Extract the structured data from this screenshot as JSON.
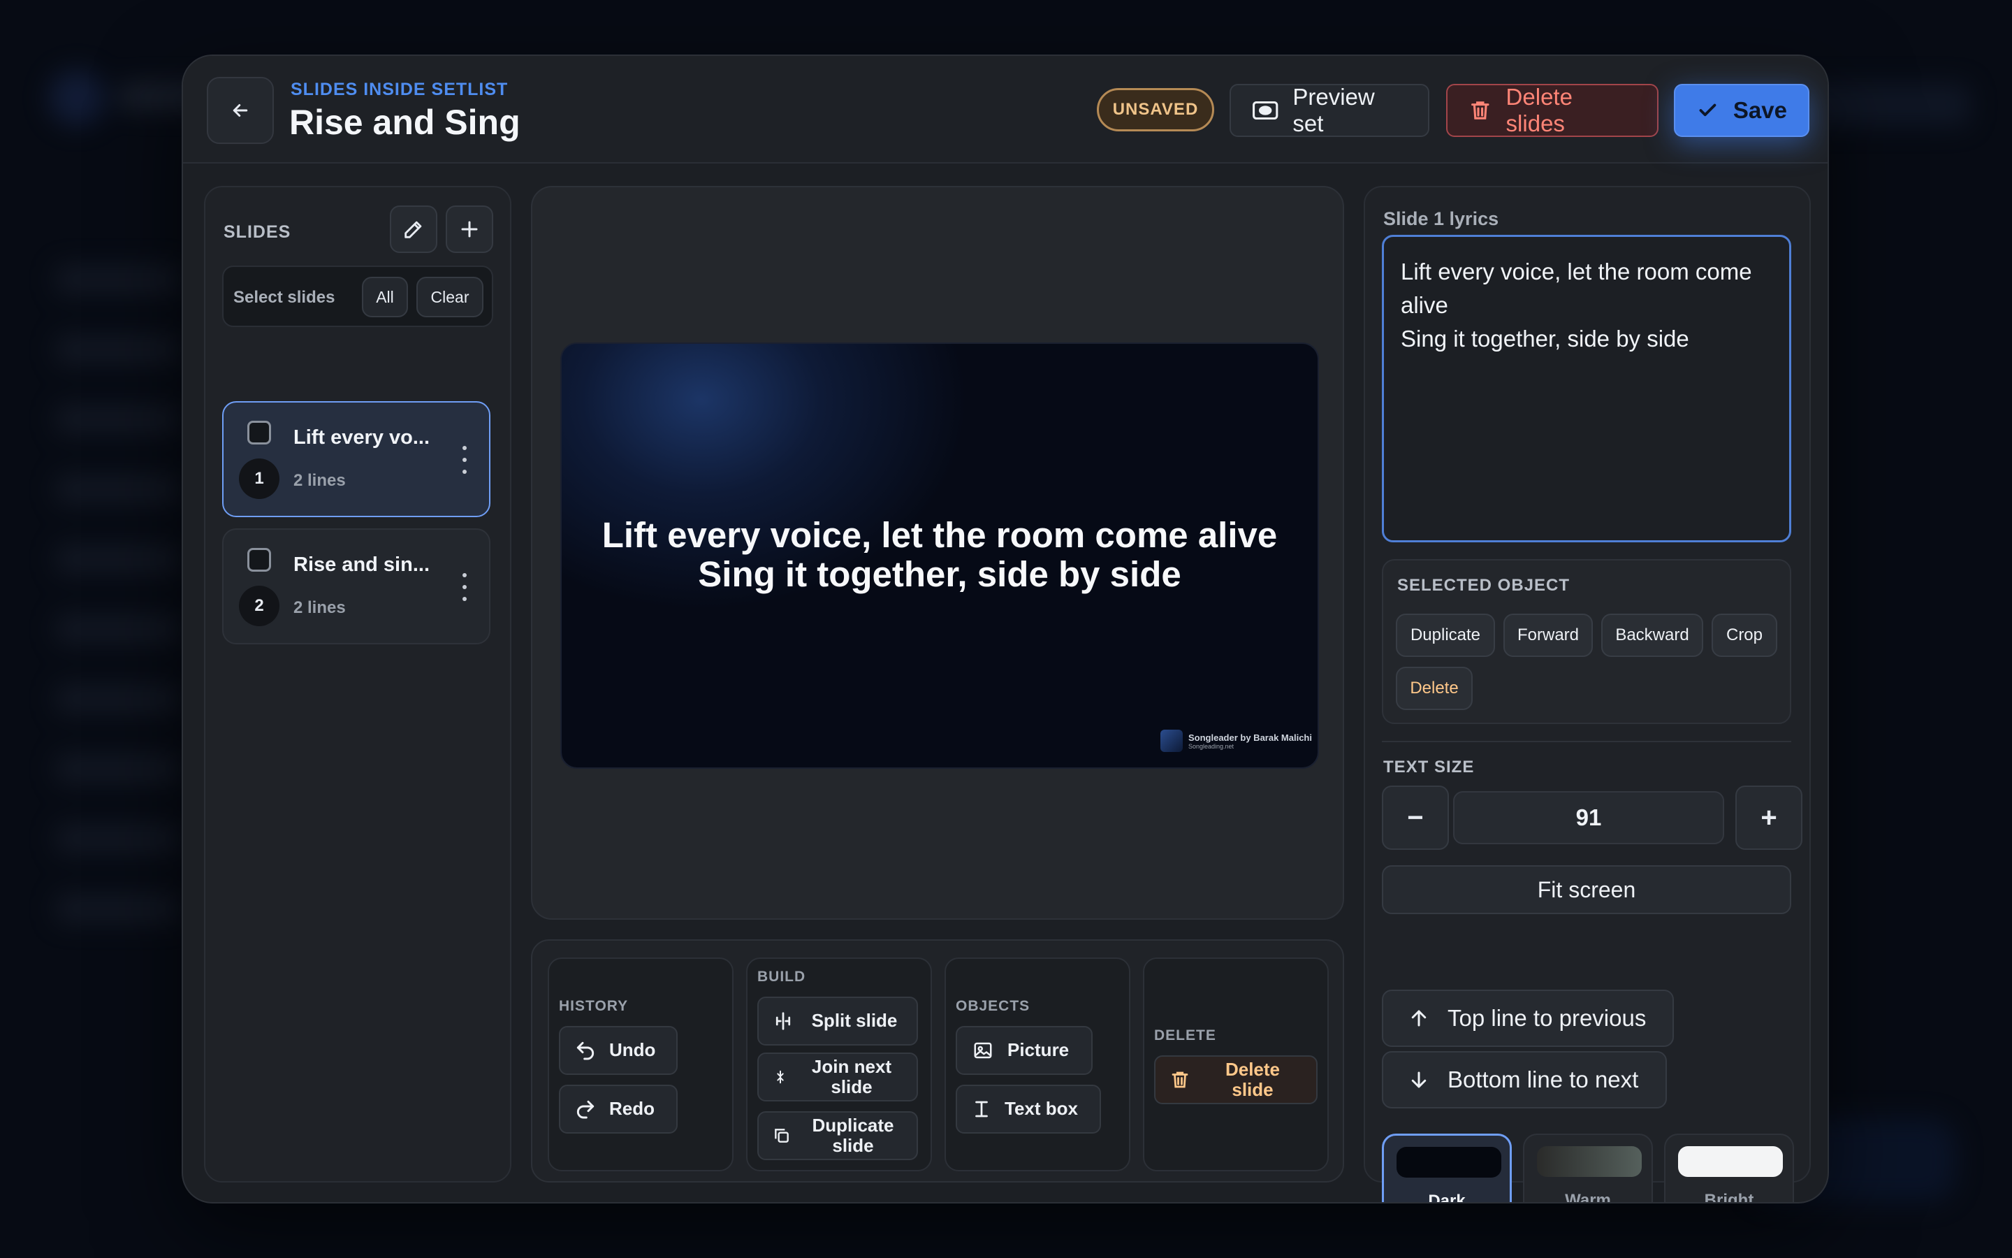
{
  "header": {
    "eyebrow": "SLIDES INSIDE SETLIST",
    "title": "Rise and Sing",
    "status_badge": "UNSAVED",
    "preview_label": "Preview set",
    "delete_label": "Delete slides",
    "save_label": "Save"
  },
  "slides_panel": {
    "label": "SLIDES",
    "select_label": "Select slides",
    "all_label": "All",
    "clear_label": "Clear",
    "items": [
      {
        "number": "1",
        "title": "Lift every vo...",
        "lines": "2 lines",
        "active": true
      },
      {
        "number": "2",
        "title": "Rise and sin...",
        "lines": "2 lines",
        "active": false
      }
    ]
  },
  "preview": {
    "line1": "Lift every voice, let the room come alive",
    "line2": "Sing it together, side by side",
    "watermark_title": "Songleader by Barak Malichi",
    "watermark_sub": "Songleading.net"
  },
  "toolbar": {
    "history": {
      "label": "HISTORY",
      "undo": "Undo",
      "redo": "Redo"
    },
    "build": {
      "label": "BUILD",
      "split": "Split slide",
      "join": "Join next slide",
      "duplicate": "Duplicate slide"
    },
    "objects": {
      "label": "OBJECTS",
      "picture": "Picture",
      "textbox": "Text box"
    },
    "delete": {
      "label": "DELETE",
      "delete_slide": "Delete slide"
    }
  },
  "editor": {
    "lyrics_label": "Slide 1 lyrics",
    "lyrics_value": "Lift every voice, let the room come alive\nSing it together, side by side",
    "selected_object": {
      "label": "SELECTED OBJECT",
      "duplicate": "Duplicate",
      "forward": "Forward",
      "backward": "Backward",
      "crop": "Crop",
      "delete": "Delete"
    },
    "text_size": {
      "label": "TEXT SIZE",
      "minus": "−",
      "value": "91",
      "plus": "+"
    },
    "fit_screen": "Fit screen",
    "top_line_prev": "Top line to previous",
    "bottom_line_next": "Bottom line to next",
    "themes": [
      {
        "name": "Dark",
        "active": true
      },
      {
        "name": "Warm",
        "active": false
      },
      {
        "name": "Bright",
        "active": false
      }
    ]
  },
  "colors": {
    "accent": "#3f7be8",
    "danger": "#ff8577",
    "warning": "#f0c48a",
    "background": "#070b14",
    "panel": "#1f2227"
  }
}
